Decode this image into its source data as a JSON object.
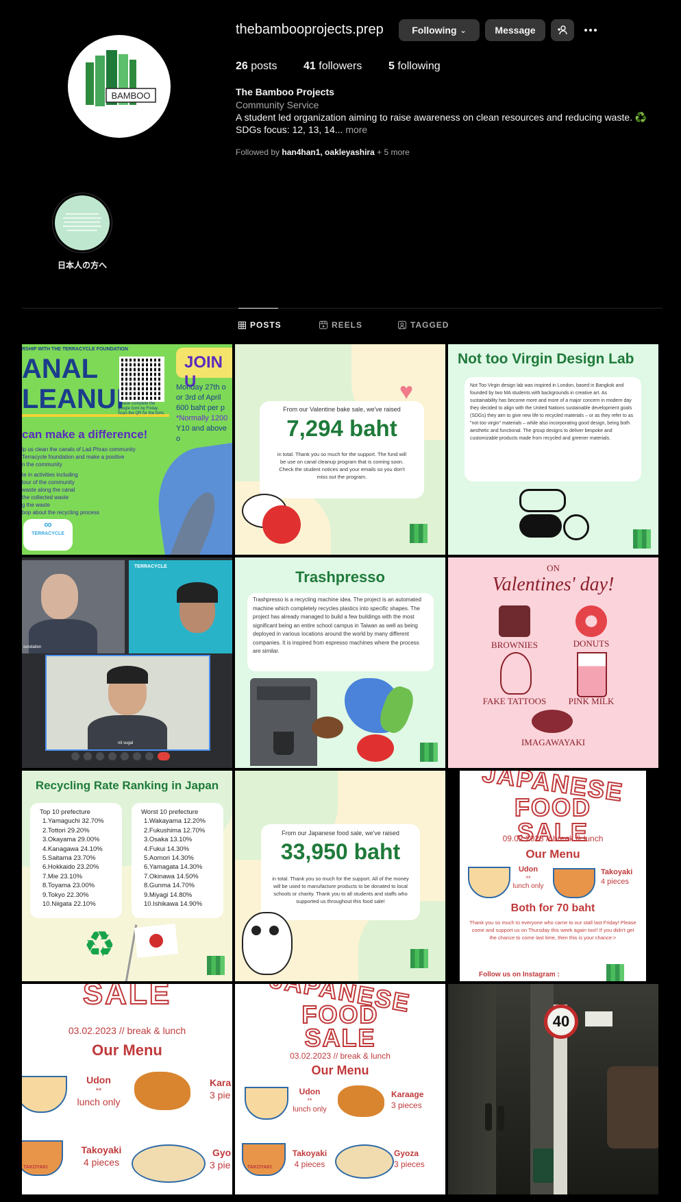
{
  "profile": {
    "username": "thebambooprojects.prep",
    "following_label": "Following",
    "message_label": "Message",
    "posts_count": "26",
    "posts_label": "posts",
    "followers_count": "41",
    "followers_label": "followers",
    "following_count": "5",
    "following_stat_label": "following",
    "full_name": "The Bamboo Projects",
    "category": "Community Service",
    "bio_line1": "A student led organization aiming to raise awareness on clean resources and reducing waste. ♻️",
    "bio_line2": "SDGs focus: 12, 13, 14...",
    "bio_more": "more",
    "followed_by_prefix": "Followed by",
    "followed_by_names": "han4han1, oakleyashira",
    "followed_by_more": "+ 5 more",
    "avatar_text": "BAMBOO"
  },
  "highlight": {
    "label": "日本人の方へ"
  },
  "tabs": [
    {
      "label": "POSTS",
      "active": true
    },
    {
      "label": "REELS",
      "active": false
    },
    {
      "label": "TAGGED",
      "active": false
    }
  ],
  "posts": {
    "p1": {
      "header": "RSHIP WITH THE TERRACYCLE FOUNDATION",
      "title1": "ANAL",
      "title2": "LEANUP",
      "join": "JOIN U",
      "qr_note": "Please complete the google form by Friday. Scan the QR for the form.",
      "date1": "Monday 27th o",
      "date2": "or 3rd of April",
      "price": "600 baht per p",
      "normally": "*Normally 1200",
      "years": "Y10 and above o",
      "slogan": "can make a difference!",
      "desc1": "lp us clean the canals of Lad Phrao community",
      "desc2": "Terracycle foundation and make a positive",
      "desc3": "n the community",
      "act1": "te in activities including",
      "act2": "tour of the community",
      "act3": "waste along the canal",
      "act4": "the collected waste",
      "act5": "g the waste",
      "act6": "bop about the recycling process",
      "terracycle": "TERRACYCLE"
    },
    "p2": {
      "intro": "From our Valentine bake sale, we've raised",
      "amount": "7,294 baht",
      "body": "in total. Thank you so much for the support. The fund will be use on canal cleanup program that is coming soon. Check the student notices and your emails so you don't miss out the program."
    },
    "p3": {
      "title": "Not too Virgin Design Lab",
      "body": "Not Too Virgin design lab was inspired in London, based in Bangkok and founded by two MA students with backgrounds in creative art. As sustainability has become more and more of a major concern in modern day they decided to align with the United Nations sustainable development goals (SDGs) they aim to give new life to recycled materials – or as they refer to as \"not too virgin\" materials – while also incorporating good design, being both aesthetic and functional. The group designs to deliver bespoke and customizable products made from recycled and greener materials."
    },
    "p4": {
      "caption1": "oundation",
      "caption2": "TERRACYCLE",
      "caption3": "nit sugal"
    },
    "p5": {
      "title": "Trashpresso",
      "body": "Trashpresso is a recycling machine idea. The project is an automated machine which completely recycles plastics into specific shapes. The project has already managed to build a few buildings with the most significant being an entire school campus in Taiwan as well as being deployed in various locations around the world by many different companies. It is inspired from espresso machines where the process are similar."
    },
    "p6": {
      "on": "ON",
      "title": "Valentines' day!",
      "items": [
        "BROWNIES",
        "DONUTS",
        "FAKE TATTOOS",
        "PINK MILK",
        "IMAGAWAYAKI"
      ]
    },
    "p7": {
      "title": "Recycling Rate Ranking in Japan",
      "top_header": "Top 10 prefecture",
      "top": [
        "1.Yamaguchi 32.70%",
        "2.Tottori 29.20%",
        "3.Okayama 29.00%",
        "4.Kanagawa 24.10%",
        "5.Saitama 23.70%",
        "6.Hokkaido 23.20%",
        "7.Mie 23.10%",
        "8.Toyama 23.00%",
        "9.Tokyo 22.30%",
        "10.Niigata 22.10%"
      ],
      "worst_header": "Worst 10 prefecture",
      "worst": [
        "1.Wakayama 12.20%",
        "2.Fukushima 12.70%",
        "3.Osaka 13.10%",
        "4.Fukui 14.30%",
        "5.Aomori 14.30%",
        "6.Yamagata 14.30%",
        "7.Okinawa 14.50%",
        "8.Gunma 14.70%",
        "9.Miyagi 14.80%",
        "10.Ishikawa 14.90%"
      ]
    },
    "p8": {
      "intro": "From our Japanese food sale, we've raised",
      "amount": "33,950 baht",
      "body": "in total. Thank you so much for the support. All of the money will be used to manufacture products to be donated to local schools or charity. Thank you to all students and staffs who supported us throughout this food sale!"
    },
    "p9": {
      "title1": "JAPANESE",
      "title2": "FOOD",
      "title3": "SALE",
      "date": "09.02.2023 // break & lunch",
      "menu": "Our Menu",
      "udon": "Udon",
      "udon_note": "**",
      "udon_note2": "lunch only",
      "takoyaki": "Takoyaki",
      "takoyaki_qty": "4 pieces",
      "combo": "Both for 70 baht",
      "thanks": "Thank you so much to everyone who came to our stall last Friday! Please come and support us on Thursday this week again too!! If you didn't get the chance to come last time, then this is your chance:>",
      "follow": "Follow us on Instagram :"
    },
    "p10": {
      "title": "SALE",
      "date": "03.02.2023 // break & lunch",
      "menu": "Our Menu",
      "udon": "Udon",
      "udon_note": "**",
      "udon_note2": "lunch only",
      "karaage": "Kara",
      "karaage_qty": "3 pie",
      "takoyaki": "Takoyaki",
      "takoyaki_qty": "4 pieces",
      "gyoza": "Gyo",
      "gyoza_qty": "3 pie",
      "tako_label": "TAKOYAKI"
    },
    "p11": {
      "title1": "JAPANESE",
      "title2": "FOOD",
      "title3": "SALE",
      "date": "03.02.2023 // break & lunch",
      "menu": "Our Menu",
      "udon": "Udon",
      "udon_note": "**",
      "udon_note2": "lunch only",
      "karaage": "Karaage",
      "karaage_qty": "3 pieces",
      "takoyaki": "Takoyaki",
      "takoyaki_qty": "4 pieces",
      "gyoza": "Gyoza",
      "gyoza_qty": "3 pieces",
      "tako_label": "TAKOYAKI"
    },
    "p12": {
      "sign": "40"
    }
  },
  "colors": {
    "bg": "#000000",
    "button": "#363636",
    "muted": "#a8a8a8",
    "bamboo_green": "#1f7a3a",
    "sale_red": "#c0393b"
  }
}
